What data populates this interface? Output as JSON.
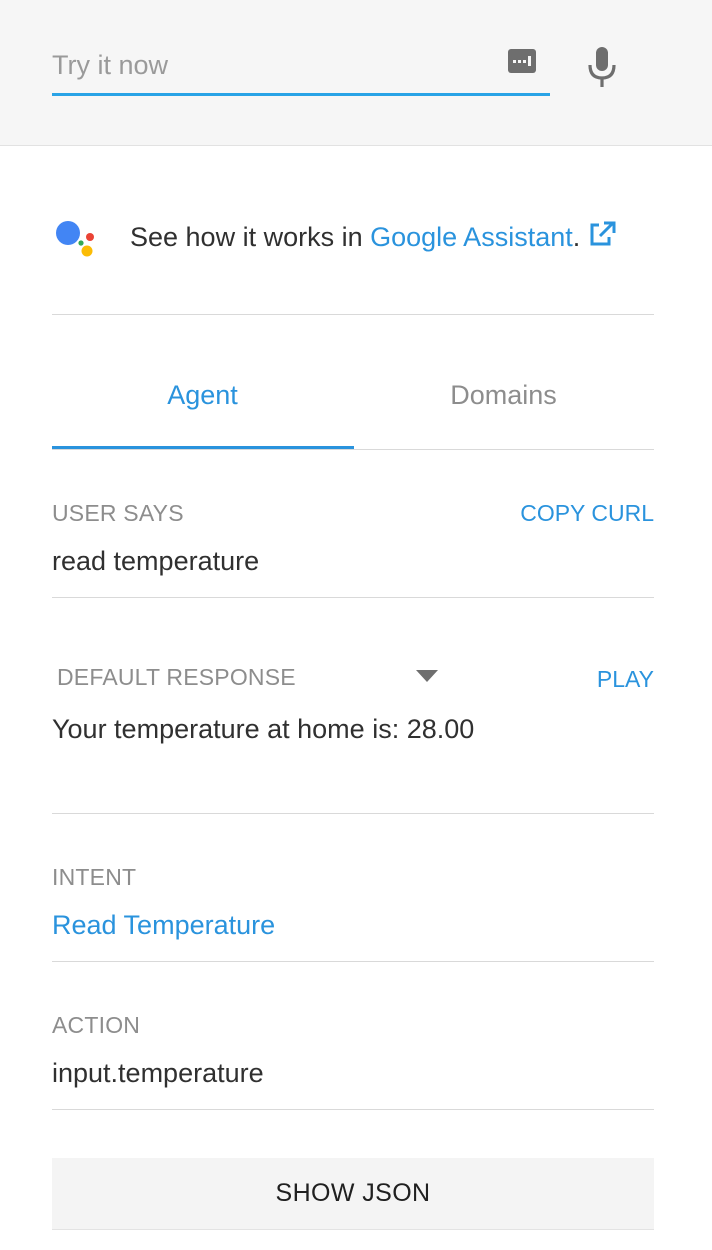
{
  "search": {
    "placeholder": "Try it now",
    "value": ""
  },
  "icons": {
    "keyboard": "keyboard-icon",
    "mic": "microphone-icon",
    "assistant": "google-assistant-logo",
    "external": "external-link-icon",
    "caret": "dropdown-caret-icon"
  },
  "assistant": {
    "prefix": "See how it works in ",
    "link_label": "Google Assistant",
    "suffix": "."
  },
  "tabs": [
    {
      "label": "Agent",
      "active": true
    },
    {
      "label": "Domains",
      "active": false
    }
  ],
  "user_says": {
    "label": "USER SAYS",
    "action": "COPY CURL",
    "value": "read temperature"
  },
  "default_response": {
    "label": "DEFAULT RESPONSE",
    "action": "PLAY",
    "value": "Your temperature at home is: 28.00"
  },
  "intent": {
    "label": "INTENT",
    "value": "Read Temperature"
  },
  "action": {
    "label": "ACTION",
    "value": "input.temperature"
  },
  "show_json": {
    "label": "SHOW JSON"
  },
  "colors": {
    "accent": "#2a93dd",
    "input_underline": "#29a3e6",
    "assistant_blue": "#4285f4",
    "assistant_red": "#ea4335",
    "assistant_yellow": "#fbbc05",
    "assistant_green": "#34a853"
  }
}
